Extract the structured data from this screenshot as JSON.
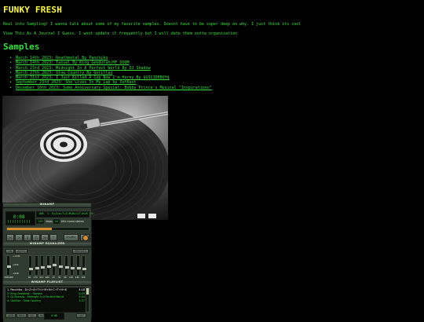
{
  "page": {
    "title": "FUNKY FRESH",
    "intro_line1": "Real into Sampling! I wanna talk about some of my favorite samples. Doesnt have to be super deep on why. I just think its cool",
    "intro_line2": "View This As A Journal I Guess. I wont update it frequently but I will date them outta organization",
    "section_heading": "Samples"
  },
  "samples": [
    "March 14th 2023: Deathmetal By Panchiko",
    "March 14th 2023: Tassel By King Geedorah/MF DOOM",
    "March 23rd 2023: Midnight In A Perfect World By DJ Shadow",
    "March 27th 2023: Slow Country By Gorillaz",
    "March 31st 2023: I Just Killed A Cop Now I'm Horny By $UICIDEBOY$",
    "September 23rd 2023: She Lives In My Lap by OutKast",
    "December 10th 2023: Some Anniversary Special: Bobby Prince's Musical \"Inspirations\""
  ],
  "winamp": {
    "title": "WINAMP",
    "time": "0:08",
    "marquee": "108. 1. D+Z+A+T+I+M+N+C+T+H+K (4:",
    "kbps": "128",
    "khz": "44",
    "mode_mono": "mono",
    "mode_stereo": "stereo",
    "seek_position": 0.55,
    "buttons": [
      "|<",
      ">",
      "||",
      "[]",
      ">|",
      "^"
    ],
    "shuffle_label": "Shuffle",
    "repeat_label": "Rep",
    "eq_title": "WINAMP EQUALIZER",
    "eq_on": "ON",
    "eq_auto": "AUTO",
    "eq_presets": "PRESETS",
    "eq_db_top": "+12db",
    "eq_db_mid": "+0db",
    "eq_db_bot": "-12db",
    "eq_preamp_label": "PREAMP",
    "eq_bands": [
      {
        "label": "60",
        "level": 0.35
      },
      {
        "label": "170",
        "level": 0.4
      },
      {
        "label": "310",
        "level": 0.45
      },
      {
        "label": "600",
        "level": 0.5
      },
      {
        "label": "1K",
        "level": 0.55
      },
      {
        "label": "3K",
        "level": 0.5
      },
      {
        "label": "6K",
        "level": 0.45
      },
      {
        "label": "12K",
        "level": 0.4
      },
      {
        "label": "14K",
        "level": 0.38
      },
      {
        "label": "16K",
        "level": 0.35
      }
    ],
    "eq_preamp_level": 0.5,
    "pl_title": "WINAMP PLAYLIST",
    "playlist": [
      {
        "title": "1. Panchiko - D+Z+A+T+I+M+N+C+T+H+K",
        "duration": "4:18",
        "active": true
      },
      {
        "title": "2. King Geedorah - Tassels",
        "duration": "4:29",
        "active": false
      },
      {
        "title": "3. DJ Shadow - Midnight In A Perfect World",
        "duration": "5:04",
        "active": false
      },
      {
        "title": "4. Gorillaz - Slow Country",
        "duration": "3:37",
        "active": false
      }
    ],
    "pl_buttons": [
      "ADD",
      "REM",
      "SEL",
      "MISC"
    ],
    "pl_mini_time": "0:08",
    "pl_list_button": "LIST"
  }
}
